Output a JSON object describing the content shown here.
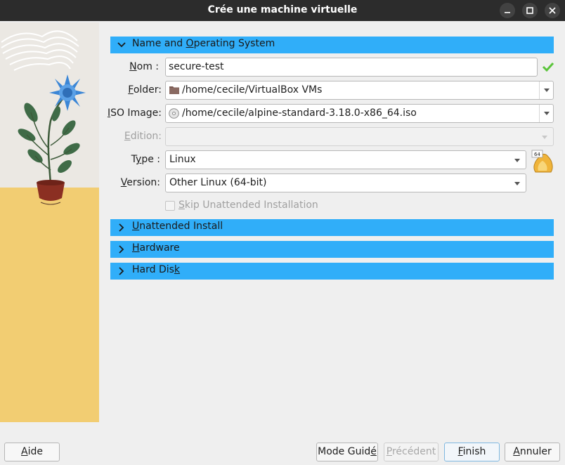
{
  "window": {
    "title": "Crée une machine virtuelle"
  },
  "sections": {
    "name_os": {
      "label_pre": "Name and ",
      "label_u": "O",
      "label_post": "perating System"
    },
    "unattended": {
      "label_u": "U",
      "label_post": "nattended Install"
    },
    "hardware": {
      "label_u": "H",
      "label_post": "ardware"
    },
    "hard_disk": {
      "label_pre": "Hard Dis",
      "label_u": "k",
      "label_post": ""
    }
  },
  "form": {
    "name": {
      "label_u": "N",
      "label_post": "om :",
      "value": "secure-test",
      "valid": true
    },
    "folder": {
      "label_u": "F",
      "label_post": "older:",
      "value": "/home/cecile/VirtualBox VMs"
    },
    "iso": {
      "label_pre": "",
      "label_u": "I",
      "label_post": "SO Image:",
      "value": "/home/cecile/alpine-standard-3.18.0-x86_64.iso"
    },
    "edition": {
      "label_u": "E",
      "label_post": "dition:",
      "value": ""
    },
    "type": {
      "label_pre": "T",
      "label_u": "y",
      "label_post": "pe :",
      "value": "Linux"
    },
    "version": {
      "label_u": "V",
      "label_post": "ersion:",
      "value": "Other Linux (64-bit)"
    },
    "skip_unattended": {
      "label_u": "S",
      "label_post": "kip Unattended Installation",
      "checked": false
    },
    "os_badge": "64"
  },
  "buttons": {
    "help": {
      "label_pre": "",
      "label_u": "A",
      "label_post": "ide"
    },
    "mode": {
      "label_pre": "Mode Guid",
      "label_u": "é",
      "label_post": ""
    },
    "previous": {
      "label_pre": "",
      "label_u": "P",
      "label_post": "récédent"
    },
    "finish": {
      "label_pre": "",
      "label_u": "F",
      "label_post": "inish"
    },
    "cancel": {
      "label_pre": "",
      "label_u": "A",
      "label_post": "nnuler"
    }
  },
  "colors": {
    "accent": "#30aef9",
    "valid_check": "#5ac43a"
  }
}
